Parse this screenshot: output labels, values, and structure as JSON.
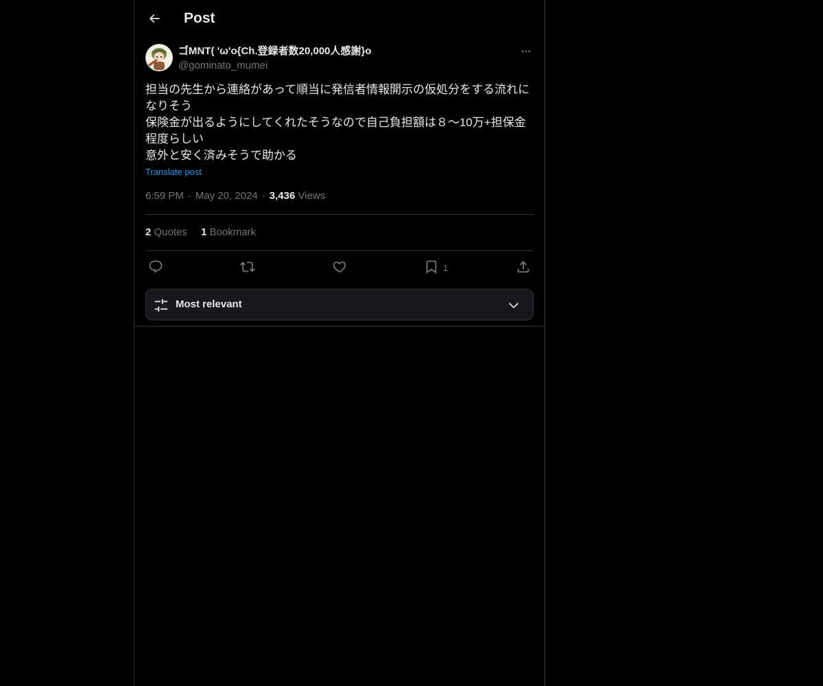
{
  "header": {
    "title": "Post",
    "back_icon": "arrow-left-icon"
  },
  "post": {
    "author": {
      "name": "ゴMNT( 'ω'o{Ch.登録者数20,000人感謝}o",
      "handle": "@gominato_mumei",
      "avatar_icon": "avatar-image"
    },
    "more_icon": "more-horizontal-icon",
    "text_lines": [
      "担当の先生から連絡があって順当に発信者情報開示の仮処分をする流れになりそう",
      "保険金が出るようにしてくれたそうなので自己負担額は８〜10万+担保金程度らしい",
      "意外と安く済みそうで助かる"
    ],
    "translate_label": "Translate post",
    "time": "6:59 PM",
    "date": "May 20, 2024",
    "views_count": "3,436",
    "views_label": "Views",
    "stats": {
      "quotes_count": "2",
      "quotes_label": "Quotes",
      "bookmarks_count": "1",
      "bookmarks_label": "Bookmark"
    },
    "actions": {
      "reply_icon": "reply-icon",
      "repost_icon": "repost-icon",
      "like_icon": "heart-icon",
      "bookmark_icon": "bookmark-icon",
      "bookmark_count": "1",
      "share_icon": "share-icon"
    }
  },
  "sort": {
    "label": "Most relevant",
    "icon": "sliders-icon",
    "chevron": "chevron-down-icon"
  },
  "colors": {
    "background": "#000000",
    "text_primary": "#e7e9ea",
    "text_secondary": "#71767b",
    "accent": "#1d9bf0",
    "border": "#2f3336"
  }
}
